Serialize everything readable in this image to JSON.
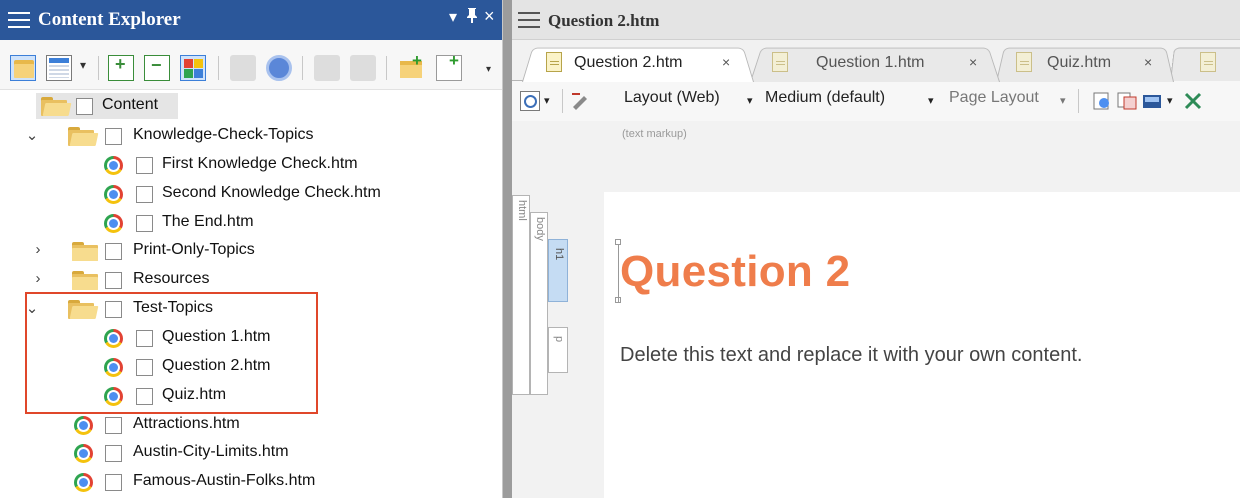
{
  "left_panel": {
    "title": "Content Explorer",
    "title_buttons": {
      "dropdown": "▾",
      "pin": "ᵖ",
      "close": "×"
    },
    "tree": [
      {
        "label": "Content",
        "kind": "root-folder"
      },
      {
        "label": "Knowledge-Check-Topics",
        "kind": "folder",
        "expanded": true
      },
      {
        "label": "First Knowledge Check.htm",
        "kind": "file"
      },
      {
        "label": "Second Knowledge Check.htm",
        "kind": "file"
      },
      {
        "label": "The End.htm",
        "kind": "file"
      },
      {
        "label": "Print-Only-Topics",
        "kind": "folder",
        "expanded": false
      },
      {
        "label": "Resources",
        "kind": "folder",
        "expanded": false
      },
      {
        "label": "Test-Topics",
        "kind": "folder",
        "expanded": true
      },
      {
        "label": "Question 1.htm",
        "kind": "file"
      },
      {
        "label": "Question 2.htm",
        "kind": "file"
      },
      {
        "label": "Quiz.htm",
        "kind": "file"
      },
      {
        "label": "Attractions.htm",
        "kind": "file"
      },
      {
        "label": "Austin-City-Limits.htm",
        "kind": "file"
      },
      {
        "label": "Famous-Austin-Folks.htm",
        "kind": "file"
      }
    ],
    "chevron_expanded": "⌄",
    "chevron_collapsed": "›"
  },
  "right_panel": {
    "title": "Question 2.htm",
    "tabs": [
      {
        "label": "Question 2.htm",
        "close": "×",
        "active": true
      },
      {
        "label": "Question 1.htm",
        "close": "×",
        "active": false
      },
      {
        "label": "Quiz.htm",
        "close": "×",
        "active": false
      }
    ],
    "toolbar": {
      "layout": "Layout (Web)",
      "medium": "Medium (default)",
      "page_layout": "Page Layout",
      "dropdown_arrow": "▾"
    },
    "markup_label": "(text markup)",
    "structure_bars": {
      "html": "html",
      "body": "body",
      "h1": "h1",
      "p": "p"
    },
    "heading": "Question 2",
    "paragraph": "Delete this text and replace it with your own content."
  },
  "colors": {
    "title_bar": "#2b579a",
    "heading": "#ef7d4b",
    "highlight_box": "#e0472a"
  }
}
